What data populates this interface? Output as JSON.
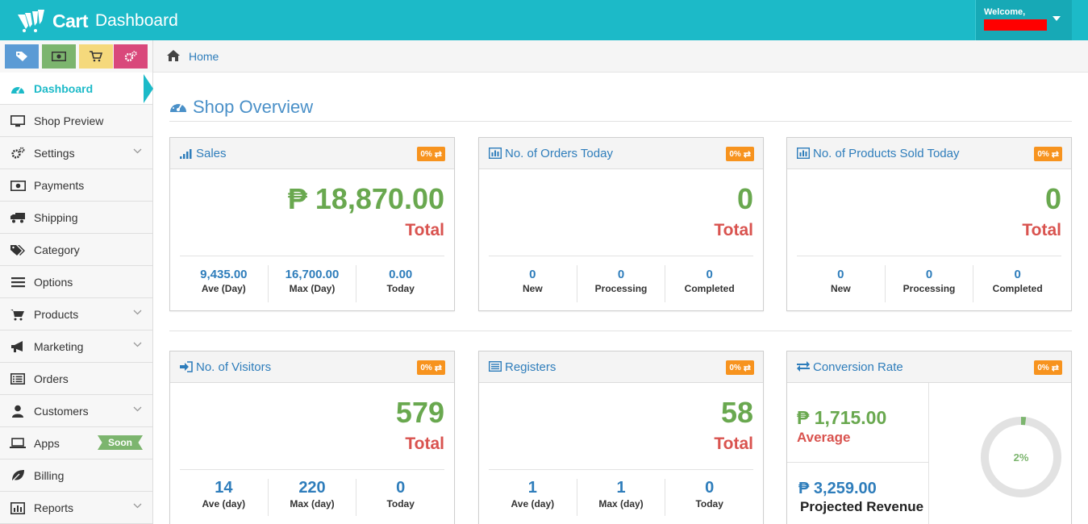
{
  "header": {
    "logo_text": "Cart",
    "app_title": "Dashboard",
    "welcome": "Welcome,"
  },
  "shortcuts": [
    {
      "name": "tags",
      "color": "#5b9bd5",
      "icon": "tag-icon"
    },
    {
      "name": "money",
      "color": "#7cb56e",
      "icon": "money-icon"
    },
    {
      "name": "cart",
      "color": "#f5d97c",
      "icon": "cart-icon"
    },
    {
      "name": "gears",
      "color": "#d9487b",
      "icon": "gears-icon"
    }
  ],
  "sidebar": {
    "items": [
      {
        "label": "Dashboard",
        "icon": "dashboard-icon",
        "active": true
      },
      {
        "label": "Shop Preview",
        "icon": "monitor-icon"
      },
      {
        "label": "Settings",
        "icon": "gears-icon",
        "expandable": true
      },
      {
        "label": "Payments",
        "icon": "money-icon"
      },
      {
        "label": "Shipping",
        "icon": "truck-icon"
      },
      {
        "label": "Category",
        "icon": "tags-icon"
      },
      {
        "label": "Options",
        "icon": "list-icon"
      },
      {
        "label": "Products",
        "icon": "cart-icon",
        "expandable": true
      },
      {
        "label": "Marketing",
        "icon": "bullhorn-icon",
        "expandable": true
      },
      {
        "label": "Orders",
        "icon": "list-alt-icon"
      },
      {
        "label": "Customers",
        "icon": "user-icon",
        "expandable": true
      },
      {
        "label": "Apps",
        "icon": "laptop-icon",
        "badge": "Soon"
      },
      {
        "label": "Billing",
        "icon": "leaf-icon"
      },
      {
        "label": "Reports",
        "icon": "bar-chart-icon",
        "expandable": true
      }
    ]
  },
  "breadcrumb": {
    "home": "Home"
  },
  "main": {
    "title": "Shop Overview",
    "panels": [
      {
        "id": "sales",
        "title": "Sales",
        "icon": "signal-icon",
        "badge": "0%",
        "value": "₱ 18,870.00",
        "total_label": "Total",
        "stats": [
          {
            "value": "9,435.00",
            "label": "Ave (Day)"
          },
          {
            "value": "16,700.00",
            "label": "Max (Day)"
          },
          {
            "value": "0.00",
            "label": "Today"
          }
        ]
      },
      {
        "id": "orders",
        "title": "No. of Orders Today",
        "icon": "bar-chart-icon",
        "badge": "0%",
        "value": "0",
        "total_label": "Total",
        "stats": [
          {
            "value": "0",
            "label": "New"
          },
          {
            "value": "0",
            "label": "Processing"
          },
          {
            "value": "0",
            "label": "Completed"
          }
        ]
      },
      {
        "id": "products_sold",
        "title": "No. of Products Sold Today",
        "icon": "bar-chart-icon",
        "badge": "0%",
        "value": "0",
        "total_label": "Total",
        "stats": [
          {
            "value": "0",
            "label": "New"
          },
          {
            "value": "0",
            "label": "Processing"
          },
          {
            "value": "0",
            "label": "Completed"
          }
        ]
      },
      {
        "id": "visitors",
        "title": "No. of Visitors",
        "icon": "sign-in-icon",
        "badge": "0%",
        "value": "579",
        "total_label": "Total",
        "stats": [
          {
            "value": "14",
            "label": "Ave (day)"
          },
          {
            "value": "220",
            "label": "Max (day)"
          },
          {
            "value": "0",
            "label": "Today"
          }
        ]
      },
      {
        "id": "registers",
        "title": "Registers",
        "icon": "list-alt-icon",
        "badge": "0%",
        "value": "58",
        "total_label": "Total",
        "stats": [
          {
            "value": "1",
            "label": "Ave (day)"
          },
          {
            "value": "1",
            "label": "Max (day)"
          },
          {
            "value": "0",
            "label": "Today"
          }
        ]
      },
      {
        "id": "conversion",
        "title": "Conversion Rate",
        "icon": "exchange-icon",
        "badge": "0%",
        "average_value": "₱ 1,715.00",
        "average_label": "Average",
        "projected_value": "₱ 3,259.00",
        "projected_label": "Projected Revenue",
        "rate_label": "2%",
        "rate_fraction": 0.02
      }
    ]
  },
  "colors": {
    "header": "#1cbac8",
    "value_green": "#69a84f",
    "total_red": "#d9534f",
    "link_blue": "#2e7dbb",
    "badge_orange": "#f7931e"
  }
}
